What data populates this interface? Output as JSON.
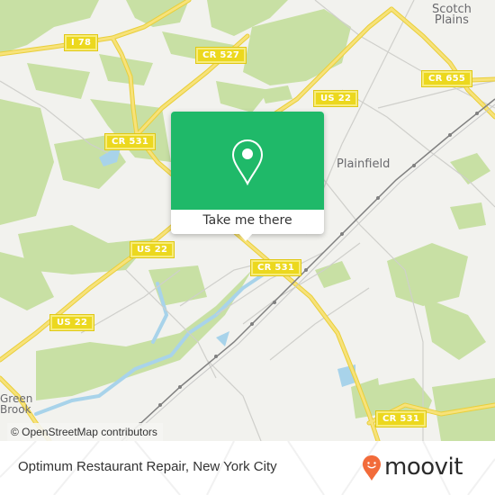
{
  "map": {
    "colors": {
      "background": "#f2f2ee",
      "park": "#c8e0a4",
      "water": "#a8d3ea",
      "highway": "#f2db4e",
      "road": "#cfcfcb",
      "rail": "#7d7d7d"
    },
    "road_labels": [
      {
        "id": "i78",
        "text": "I 78"
      },
      {
        "id": "cr527",
        "text": "CR 527"
      },
      {
        "id": "cr655",
        "text": "CR 655"
      },
      {
        "id": "us22-north",
        "text": "US 22"
      },
      {
        "id": "cr531-north",
        "text": "CR 531"
      },
      {
        "id": "us22-mid",
        "text": "US 22"
      },
      {
        "id": "us22-west",
        "text": "US 22"
      },
      {
        "id": "cr531-center",
        "text": "CR 531"
      },
      {
        "id": "cr531-south",
        "text": "CR 531"
      }
    ],
    "place_labels": [
      {
        "id": "scotch-plains",
        "line1": "Scotch",
        "line2": "Plains"
      },
      {
        "id": "plainfield",
        "line1": "Plainfield"
      },
      {
        "id": "green-brook",
        "line1": "Green",
        "line2": "Brook"
      }
    ],
    "attribution": "© OpenStreetMap contributors"
  },
  "popup": {
    "icon": "map-pin-icon",
    "button_label": "Take me there",
    "accent_color": "#1fb969"
  },
  "footer": {
    "location_title": "Optimum Restaurant Repair, New York City",
    "brand": "moovit",
    "brand_color": "#f26b3a"
  }
}
